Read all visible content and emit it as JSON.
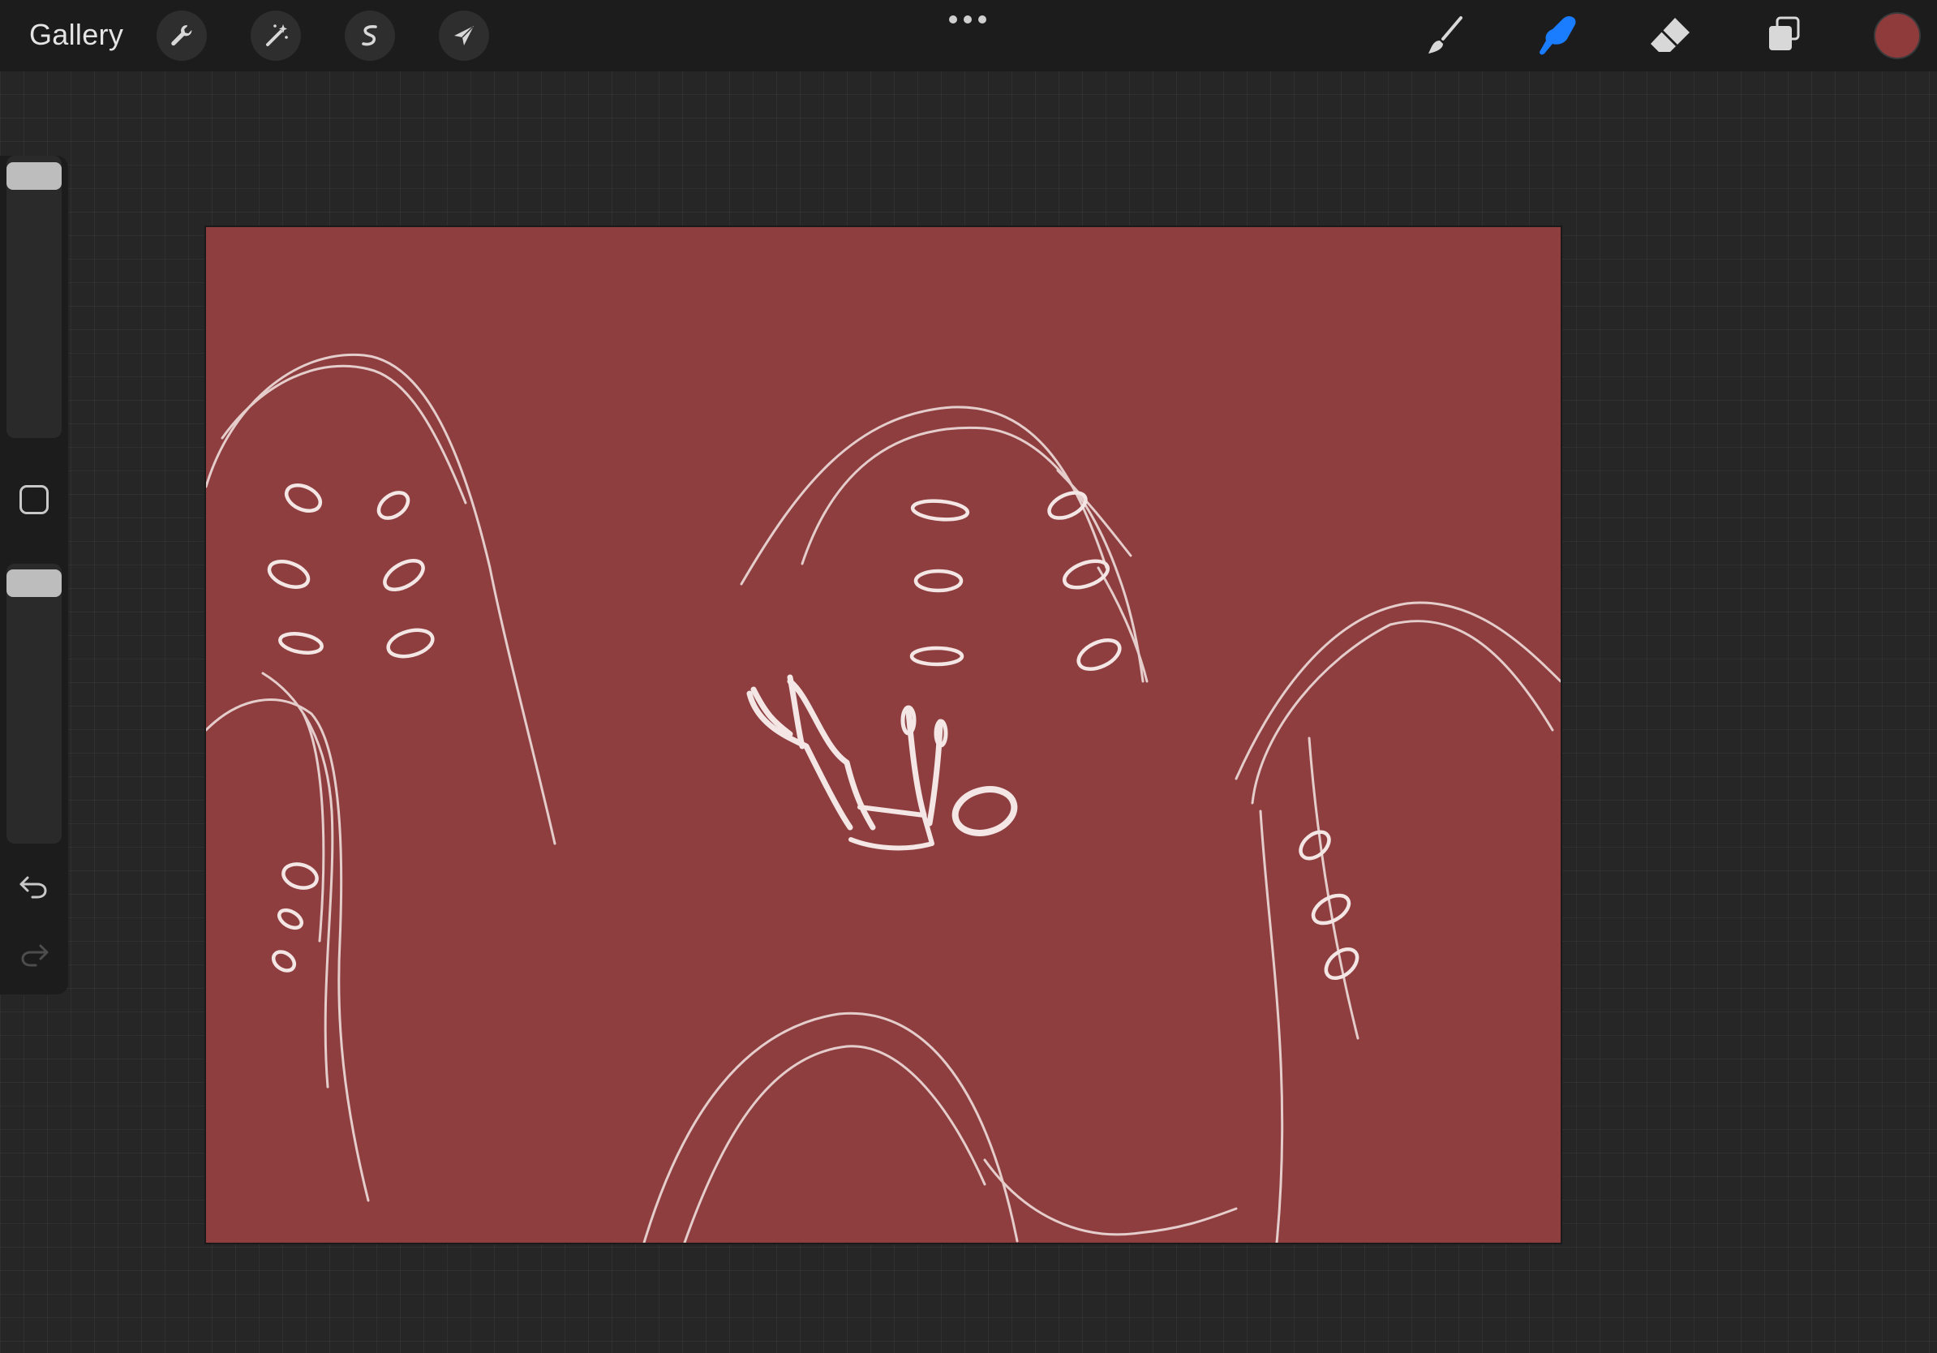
{
  "topbar": {
    "gallery_label": "Gallery",
    "left_tools": [
      {
        "name": "actions",
        "icon": "wrench-icon"
      },
      {
        "name": "adjustments",
        "icon": "magic-wand-icon"
      },
      {
        "name": "selection",
        "icon": "selection-s-icon"
      },
      {
        "name": "transform",
        "icon": "arrow-cursor-icon"
      }
    ],
    "more_icon": "more-dots-icon",
    "right_tools": [
      {
        "name": "brush",
        "icon": "brush-icon",
        "active": false
      },
      {
        "name": "smudge",
        "icon": "smudge-finger-icon",
        "active": true
      },
      {
        "name": "eraser",
        "icon": "eraser-icon",
        "active": false
      },
      {
        "name": "layers",
        "icon": "layers-icon",
        "active": false
      }
    ],
    "current_color": "#8f3b3c",
    "active_tool_color": "#1a7cff"
  },
  "sidebar": {
    "size_slider_icon": "size-slider",
    "modify_button_icon": "square-modify-icon",
    "opacity_slider_icon": "opacity-slider",
    "undo_icon": "undo-icon",
    "redo_icon": "redo-icon",
    "redo_enabled": false
  },
  "canvas": {
    "background_color": "#8f3e40",
    "stroke_color": "#f3e6e4"
  }
}
